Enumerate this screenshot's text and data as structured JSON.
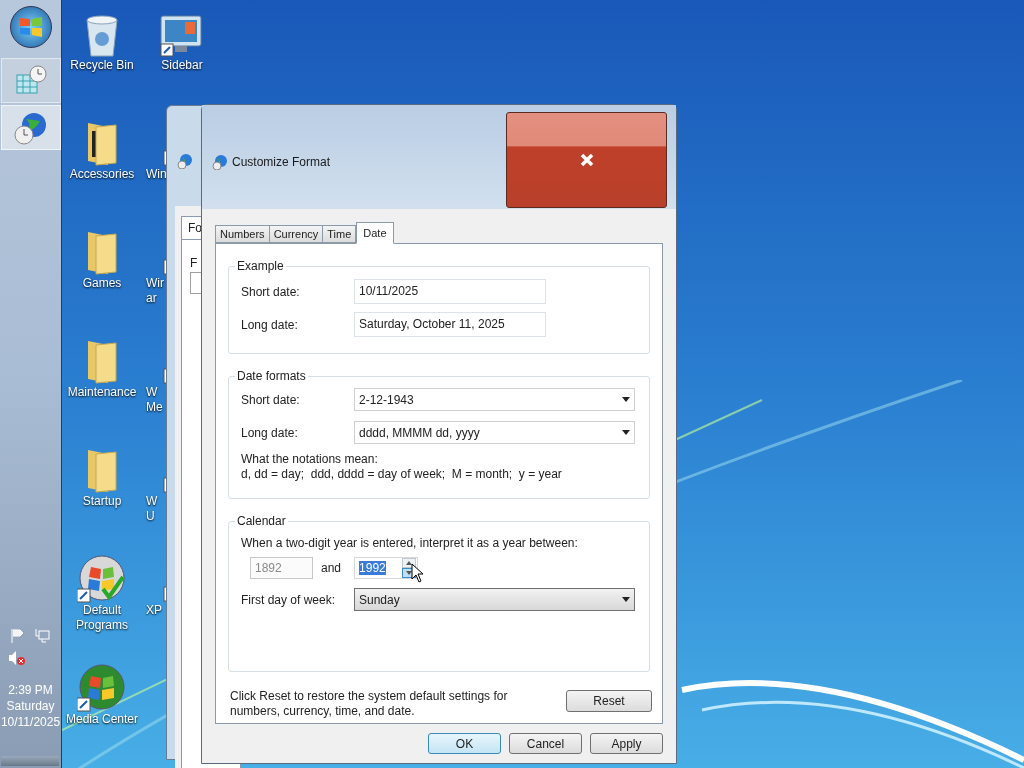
{
  "taskbar": {
    "buttons": [
      {
        "kind": "calendar",
        "selected": false
      },
      {
        "kind": "globe-clock",
        "selected": true
      }
    ],
    "tray": {
      "volume_muted": true
    },
    "clock": [
      "2:39 PM",
      "Saturday",
      "10/11/2025"
    ]
  },
  "desktop": {
    "columns": [
      [
        {
          "kind": "recycle",
          "label": [
            "Recycle Bin"
          ]
        },
        {
          "kind": "folder-docs",
          "label": [
            "Accessories"
          ]
        },
        {
          "kind": "folder",
          "label": [
            "Games"
          ]
        },
        {
          "kind": "folder-doc",
          "label": [
            "Maintenance"
          ]
        },
        {
          "kind": "folder",
          "label": [
            "Startup"
          ]
        },
        {
          "kind": "default-programs",
          "label": [
            "Default",
            "Programs"
          ]
        },
        {
          "kind": "media-center",
          "label": [
            "Media Center"
          ]
        }
      ],
      [
        {
          "kind": "sidebar",
          "label": [
            "Sidebar"
          ]
        },
        {
          "kind": "shortcut",
          "label": [
            "Win"
          ]
        },
        {
          "kind": "shortcut",
          "label": [
            "Wir",
            "ar"
          ]
        },
        {
          "kind": "shortcut",
          "label": [
            "W",
            "Me"
          ]
        },
        {
          "kind": "shortcut",
          "label": [
            "W",
            "U"
          ]
        },
        {
          "kind": "shortcut",
          "label": [
            "XP"
          ]
        }
      ]
    ]
  },
  "back_window": {
    "tab": "Fo",
    "label": "F"
  },
  "dialog": {
    "title": "Customize Format",
    "tabs": [
      {
        "label": "Numbers",
        "selected": false
      },
      {
        "label": "Currency",
        "selected": false
      },
      {
        "label": "Time",
        "selected": false
      },
      {
        "label": "Date",
        "selected": true
      }
    ],
    "example": {
      "title": "Example",
      "rows": [
        {
          "label": "Short date:",
          "value": "10/11/2025"
        },
        {
          "label": "Long date:",
          "value": "Saturday, October 11, 2025"
        }
      ]
    },
    "formats": {
      "title": "Date formats",
      "rows": [
        {
          "label": "Short date:",
          "value": "2-12-1943",
          "highlighted": false
        },
        {
          "label": "Long date:",
          "value": "dddd, MMMM dd, yyyy",
          "highlighted": false
        }
      ],
      "notes": [
        "What the notations mean:",
        "d, dd = day;  ddd, dddd = day of week;  M = month;  y = year"
      ]
    },
    "calendar": {
      "title": "Calendar",
      "prompt": "When a two-digit year is entered, interpret it as a year between:",
      "from": {
        "value": "1892",
        "disabled": true
      },
      "and": "and",
      "to": {
        "value": "1992",
        "text_selected": true
      },
      "first_day": {
        "label": "First day of week:",
        "value": "Sunday",
        "highlighted": true
      }
    },
    "reset": {
      "text": "Click Reset to restore the system default settings for numbers, currency, time, and date.",
      "button": "Reset"
    },
    "buttons": [
      {
        "label": "OK",
        "default": true
      },
      {
        "label": "Cancel",
        "default": false
      },
      {
        "label": "Apply",
        "default": false
      }
    ]
  }
}
